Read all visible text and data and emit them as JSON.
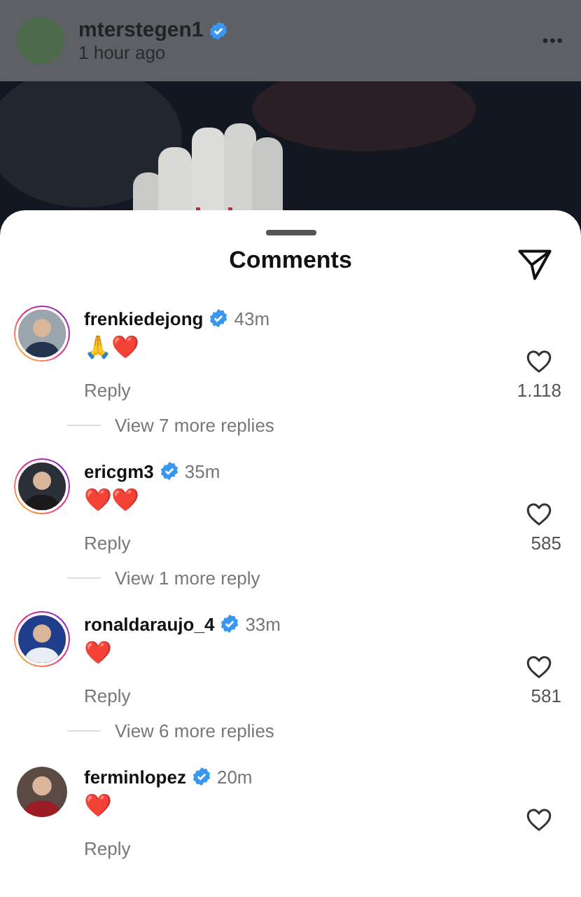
{
  "post": {
    "username": "mterstegen1",
    "verified": true,
    "time": "1 hour ago",
    "more": "•••"
  },
  "sheet": {
    "title": "Comments"
  },
  "comments": [
    {
      "username": "frenkiedejong",
      "verified": true,
      "time": "43m",
      "text": "🙏❤️",
      "story_ring": true,
      "reply": "Reply",
      "likes": "1.118",
      "liked": false,
      "view_replies": "View 7 more replies"
    },
    {
      "username": "ericgm3",
      "verified": true,
      "time": "35m",
      "text": "❤️❤️",
      "story_ring": true,
      "reply": "Reply",
      "likes": "585",
      "liked": false,
      "view_replies": "View 1 more reply"
    },
    {
      "username": "ronaldaraujo_4",
      "verified": true,
      "time": "33m",
      "text": "❤️",
      "story_ring": true,
      "reply": "Reply",
      "likes": "581",
      "liked": false,
      "view_replies": "View 6 more replies"
    },
    {
      "username": "ferminlopez",
      "verified": true,
      "time": "20m",
      "text": "❤️",
      "story_ring": false,
      "reply": "Reply",
      "liked": false
    }
  ]
}
